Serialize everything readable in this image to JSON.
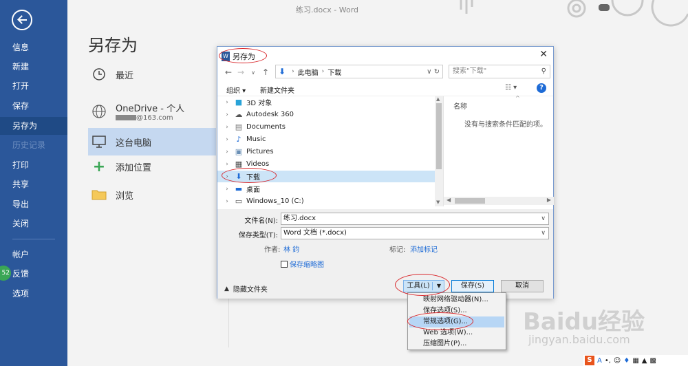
{
  "window": {
    "title": "练习.docx  -  Word"
  },
  "nav": {
    "items": [
      "信息",
      "新建",
      "打开",
      "保存",
      "另存为",
      "历史记录",
      "打印",
      "共享",
      "导出",
      "关闭",
      "帐户",
      "反馈",
      "选项"
    ],
    "badge": "52"
  },
  "backstage": {
    "title": "另存为",
    "recent": "最近",
    "onedrive": {
      "name": "OneDrive - 个人",
      "email": "@163.com"
    },
    "this_pc": "这台电脑",
    "add_place": "添加位置",
    "browse": "浏览"
  },
  "dialog": {
    "title": "另存为",
    "close": "✕",
    "breadcrumb": {
      "root": "此电脑",
      "current": "下载"
    },
    "search_placeholder": "搜索\"下载\"",
    "toolbar": {
      "organize": "组织 ▾",
      "new_folder": "新建文件夹"
    },
    "tree": [
      {
        "label": "3D 对象",
        "icon": "cube-icon"
      },
      {
        "label": "Autodesk 360",
        "icon": "cloud-icon"
      },
      {
        "label": "Documents",
        "icon": "documents-icon"
      },
      {
        "label": "Music",
        "icon": "music-icon"
      },
      {
        "label": "Pictures",
        "icon": "pictures-icon"
      },
      {
        "label": "Videos",
        "icon": "videos-icon"
      },
      {
        "label": "下载",
        "icon": "download-icon",
        "selected": true
      },
      {
        "label": "桌面",
        "icon": "desktop-icon"
      },
      {
        "label": "Windows_10 (C:)",
        "icon": "drive-icon"
      }
    ],
    "content": {
      "column_name": "名称",
      "empty_message": "没有与搜索条件匹配的项。"
    },
    "form": {
      "filename_label": "文件名(N):",
      "filename_value": "练习.docx",
      "filetype_label": "保存类型(T):",
      "filetype_value": "Word 文档 (*.docx)",
      "author_label": "作者:",
      "author_value": "林 鈞",
      "tags_label": "标记:",
      "tags_value": "添加标记",
      "thumbnail_label": "保存缩略图"
    },
    "footer": {
      "hide_folders": "隐藏文件夹",
      "tools": "工具(L)",
      "save": "保存(S)",
      "cancel": "取消"
    },
    "tools_menu": [
      "映射网络驱动器(N)...",
      "保存选项(S)...",
      "常规选项(G)...",
      "Web 选项(W)...",
      "压缩图片(P)..."
    ]
  },
  "watermark": {
    "brand": "Baidu经验",
    "url": "jingyan.baidu.com"
  },
  "colors": {
    "nav_blue": "#2b579a",
    "annotation_red": "#d9262a",
    "selection_blue": "#cce4f7"
  }
}
